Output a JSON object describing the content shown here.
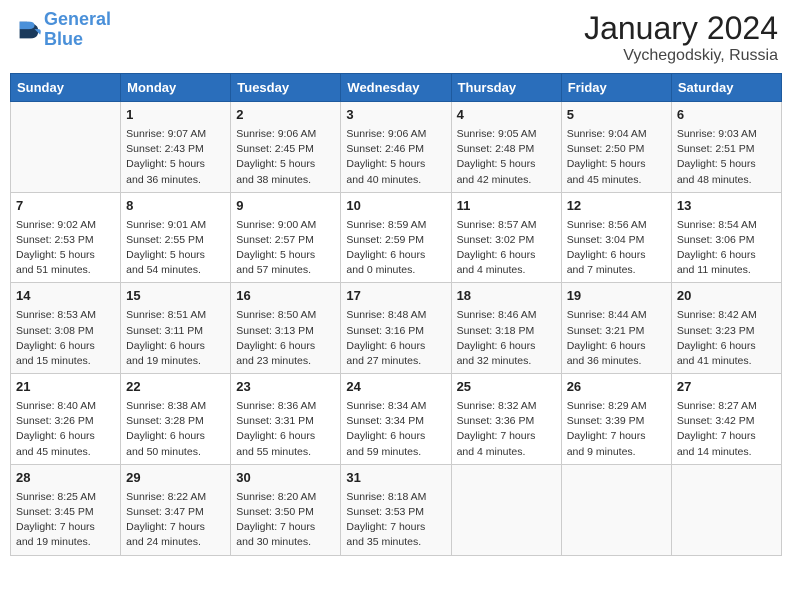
{
  "header": {
    "logo_line1": "General",
    "logo_line2": "Blue",
    "title": "January 2024",
    "subtitle": "Vychegodskiy, Russia"
  },
  "weekdays": [
    "Sunday",
    "Monday",
    "Tuesday",
    "Wednesday",
    "Thursday",
    "Friday",
    "Saturday"
  ],
  "weeks": [
    [
      {
        "day": "",
        "sunrise": "",
        "sunset": "",
        "daylight": ""
      },
      {
        "day": "1",
        "sunrise": "Sunrise: 9:07 AM",
        "sunset": "Sunset: 2:43 PM",
        "daylight": "Daylight: 5 hours and 36 minutes."
      },
      {
        "day": "2",
        "sunrise": "Sunrise: 9:06 AM",
        "sunset": "Sunset: 2:45 PM",
        "daylight": "Daylight: 5 hours and 38 minutes."
      },
      {
        "day": "3",
        "sunrise": "Sunrise: 9:06 AM",
        "sunset": "Sunset: 2:46 PM",
        "daylight": "Daylight: 5 hours and 40 minutes."
      },
      {
        "day": "4",
        "sunrise": "Sunrise: 9:05 AM",
        "sunset": "Sunset: 2:48 PM",
        "daylight": "Daylight: 5 hours and 42 minutes."
      },
      {
        "day": "5",
        "sunrise": "Sunrise: 9:04 AM",
        "sunset": "Sunset: 2:50 PM",
        "daylight": "Daylight: 5 hours and 45 minutes."
      },
      {
        "day": "6",
        "sunrise": "Sunrise: 9:03 AM",
        "sunset": "Sunset: 2:51 PM",
        "daylight": "Daylight: 5 hours and 48 minutes."
      }
    ],
    [
      {
        "day": "7",
        "sunrise": "Sunrise: 9:02 AM",
        "sunset": "Sunset: 2:53 PM",
        "daylight": "Daylight: 5 hours and 51 minutes."
      },
      {
        "day": "8",
        "sunrise": "Sunrise: 9:01 AM",
        "sunset": "Sunset: 2:55 PM",
        "daylight": "Daylight: 5 hours and 54 minutes."
      },
      {
        "day": "9",
        "sunrise": "Sunrise: 9:00 AM",
        "sunset": "Sunset: 2:57 PM",
        "daylight": "Daylight: 5 hours and 57 minutes."
      },
      {
        "day": "10",
        "sunrise": "Sunrise: 8:59 AM",
        "sunset": "Sunset: 2:59 PM",
        "daylight": "Daylight: 6 hours and 0 minutes."
      },
      {
        "day": "11",
        "sunrise": "Sunrise: 8:57 AM",
        "sunset": "Sunset: 3:02 PM",
        "daylight": "Daylight: 6 hours and 4 minutes."
      },
      {
        "day": "12",
        "sunrise": "Sunrise: 8:56 AM",
        "sunset": "Sunset: 3:04 PM",
        "daylight": "Daylight: 6 hours and 7 minutes."
      },
      {
        "day": "13",
        "sunrise": "Sunrise: 8:54 AM",
        "sunset": "Sunset: 3:06 PM",
        "daylight": "Daylight: 6 hours and 11 minutes."
      }
    ],
    [
      {
        "day": "14",
        "sunrise": "Sunrise: 8:53 AM",
        "sunset": "Sunset: 3:08 PM",
        "daylight": "Daylight: 6 hours and 15 minutes."
      },
      {
        "day": "15",
        "sunrise": "Sunrise: 8:51 AM",
        "sunset": "Sunset: 3:11 PM",
        "daylight": "Daylight: 6 hours and 19 minutes."
      },
      {
        "day": "16",
        "sunrise": "Sunrise: 8:50 AM",
        "sunset": "Sunset: 3:13 PM",
        "daylight": "Daylight: 6 hours and 23 minutes."
      },
      {
        "day": "17",
        "sunrise": "Sunrise: 8:48 AM",
        "sunset": "Sunset: 3:16 PM",
        "daylight": "Daylight: 6 hours and 27 minutes."
      },
      {
        "day": "18",
        "sunrise": "Sunrise: 8:46 AM",
        "sunset": "Sunset: 3:18 PM",
        "daylight": "Daylight: 6 hours and 32 minutes."
      },
      {
        "day": "19",
        "sunrise": "Sunrise: 8:44 AM",
        "sunset": "Sunset: 3:21 PM",
        "daylight": "Daylight: 6 hours and 36 minutes."
      },
      {
        "day": "20",
        "sunrise": "Sunrise: 8:42 AM",
        "sunset": "Sunset: 3:23 PM",
        "daylight": "Daylight: 6 hours and 41 minutes."
      }
    ],
    [
      {
        "day": "21",
        "sunrise": "Sunrise: 8:40 AM",
        "sunset": "Sunset: 3:26 PM",
        "daylight": "Daylight: 6 hours and 45 minutes."
      },
      {
        "day": "22",
        "sunrise": "Sunrise: 8:38 AM",
        "sunset": "Sunset: 3:28 PM",
        "daylight": "Daylight: 6 hours and 50 minutes."
      },
      {
        "day": "23",
        "sunrise": "Sunrise: 8:36 AM",
        "sunset": "Sunset: 3:31 PM",
        "daylight": "Daylight: 6 hours and 55 minutes."
      },
      {
        "day": "24",
        "sunrise": "Sunrise: 8:34 AM",
        "sunset": "Sunset: 3:34 PM",
        "daylight": "Daylight: 6 hours and 59 minutes."
      },
      {
        "day": "25",
        "sunrise": "Sunrise: 8:32 AM",
        "sunset": "Sunset: 3:36 PM",
        "daylight": "Daylight: 7 hours and 4 minutes."
      },
      {
        "day": "26",
        "sunrise": "Sunrise: 8:29 AM",
        "sunset": "Sunset: 3:39 PM",
        "daylight": "Daylight: 7 hours and 9 minutes."
      },
      {
        "day": "27",
        "sunrise": "Sunrise: 8:27 AM",
        "sunset": "Sunset: 3:42 PM",
        "daylight": "Daylight: 7 hours and 14 minutes."
      }
    ],
    [
      {
        "day": "28",
        "sunrise": "Sunrise: 8:25 AM",
        "sunset": "Sunset: 3:45 PM",
        "daylight": "Daylight: 7 hours and 19 minutes."
      },
      {
        "day": "29",
        "sunrise": "Sunrise: 8:22 AM",
        "sunset": "Sunset: 3:47 PM",
        "daylight": "Daylight: 7 hours and 24 minutes."
      },
      {
        "day": "30",
        "sunrise": "Sunrise: 8:20 AM",
        "sunset": "Sunset: 3:50 PM",
        "daylight": "Daylight: 7 hours and 30 minutes."
      },
      {
        "day": "31",
        "sunrise": "Sunrise: 8:18 AM",
        "sunset": "Sunset: 3:53 PM",
        "daylight": "Daylight: 7 hours and 35 minutes."
      },
      {
        "day": "",
        "sunrise": "",
        "sunset": "",
        "daylight": ""
      },
      {
        "day": "",
        "sunrise": "",
        "sunset": "",
        "daylight": ""
      },
      {
        "day": "",
        "sunrise": "",
        "sunset": "",
        "daylight": ""
      }
    ]
  ]
}
